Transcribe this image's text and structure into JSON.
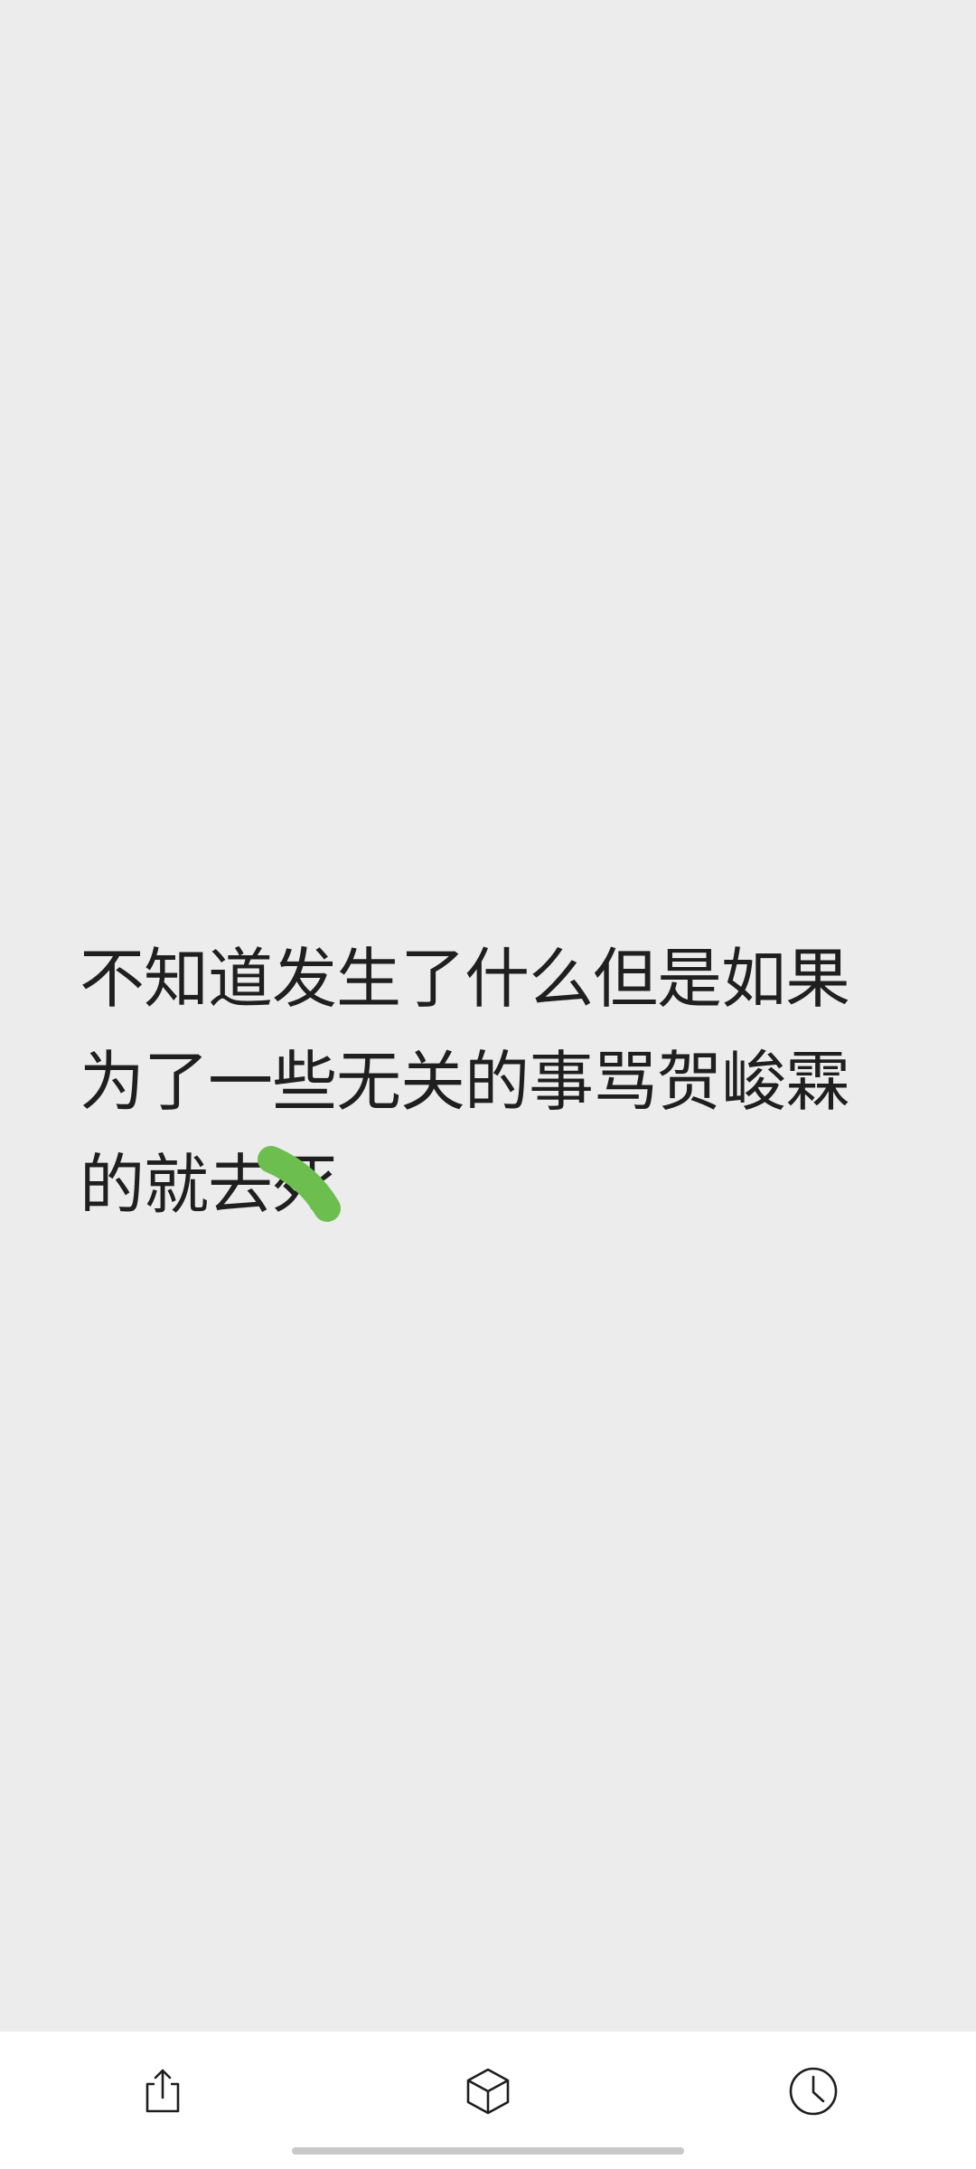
{
  "note": {
    "lines": [
      "不知道发生了什么但是如果",
      "为了一些无关的事骂贺峻霖",
      "的就去死"
    ]
  },
  "annotation": {
    "color": "#6cbf4e"
  },
  "toolbar": {
    "icons": [
      "share-icon",
      "cube-icon",
      "clock-icon"
    ]
  }
}
